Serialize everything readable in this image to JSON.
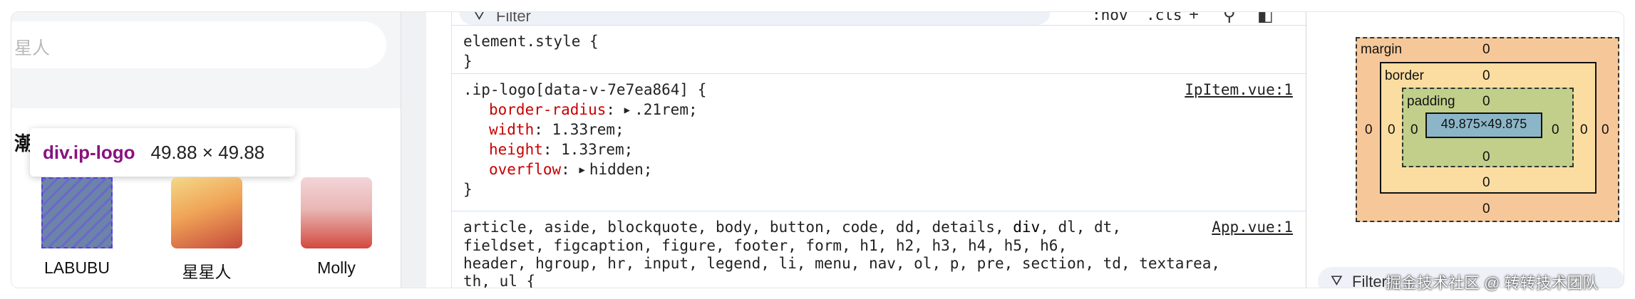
{
  "mobile": {
    "search_placeholder": "星人",
    "section_char": "潮",
    "tooltip": {
      "name": "div.ip-logo",
      "size": "49.88 × 49.88"
    },
    "ip_items": [
      {
        "name": "LABUBU"
      },
      {
        "name": "星星人"
      },
      {
        "name": "Molly"
      }
    ]
  },
  "styles": {
    "filter_placeholder": "Filter",
    "toolbar": {
      "hov": ":hov",
      "cls": ".cls"
    },
    "element_style": {
      "selector": "element.style {",
      "close": "}"
    },
    "ip_logo_rule": {
      "selector": ".ip-logo[data-v-7e7ea864] {",
      "source": "IpItem.vue:1",
      "declarations": [
        {
          "prop": "border-radius",
          "value": ".21rem;",
          "expandable": true
        },
        {
          "prop": "width",
          "value": "1.33rem;",
          "expandable": false
        },
        {
          "prop": "height",
          "value": "1.33rem;",
          "expandable": false
        },
        {
          "prop": "overflow",
          "value": "hidden;",
          "expandable": true
        }
      ],
      "close": "}"
    },
    "app_rule": {
      "line1": "article, aside, blockquote, body, button, code, dd, details, ",
      "line1_bold": "div",
      "line1_rest": ", dl, dt,",
      "line2": "fieldset, figcaption, figure, footer, form, h1, h2, h3, h4, h5, h6,",
      "line3": "header, hgroup, hr, input, legend, li, menu, nav, ol, p, pre, section, td, textarea,",
      "line4": "th, ul {",
      "source": "App.vue:1"
    }
  },
  "box_model": {
    "margin_label": "margin",
    "border_label": "border",
    "padding_label": "padding",
    "margin": {
      "top": "0",
      "right": "0",
      "bottom": "0",
      "left": "0"
    },
    "border": {
      "top": "0",
      "right": "0",
      "bottom": "0",
      "left": "0"
    },
    "padding": {
      "top": "0",
      "right": "0",
      "bottom": "0",
      "left": "0"
    },
    "content": "49.875×49.875",
    "filter_text": "Filter"
  },
  "watermark": "掘金技术社区 @ 转转技术团队",
  "colors": {
    "tooltip_name": "#881280",
    "css_property": "#c80000",
    "margin_bg": "#f6c899",
    "border_bg": "#fcdda1",
    "padding_bg": "#c2cf8a",
    "content_bg": "#8cb6c7"
  }
}
